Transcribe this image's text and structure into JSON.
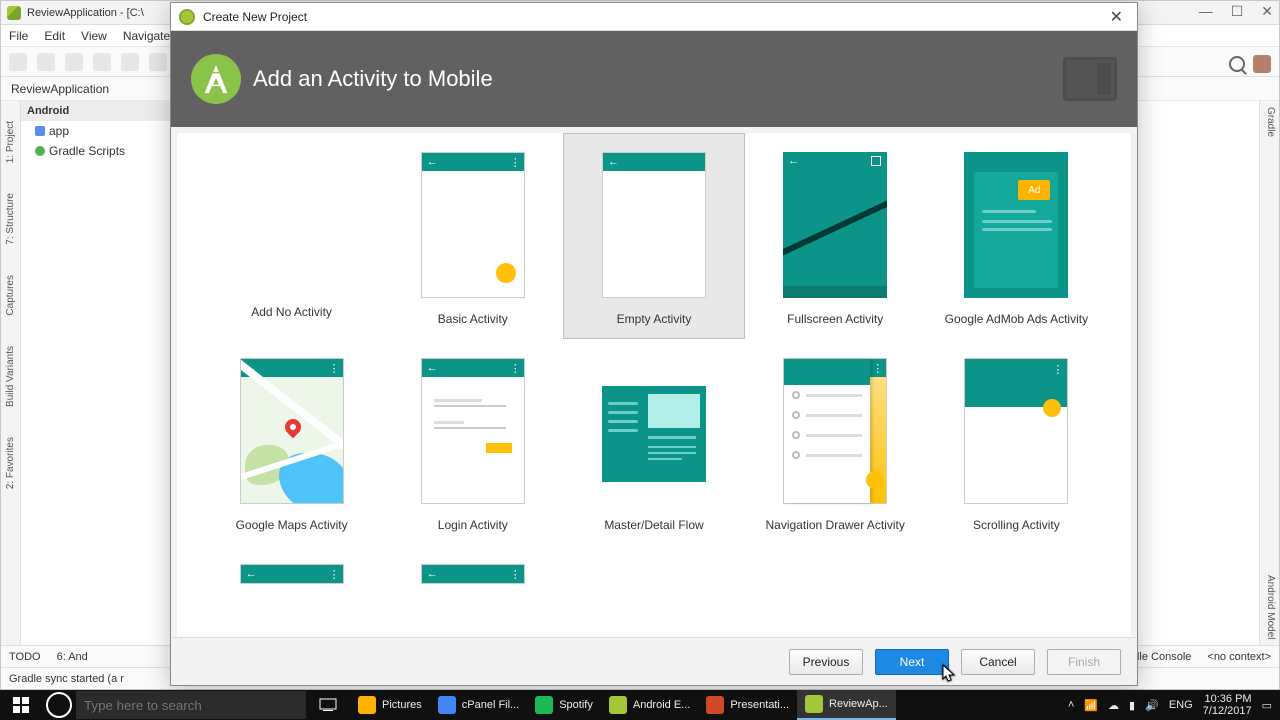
{
  "ide": {
    "title": "ReviewApplication - [C:\\",
    "menu": [
      "File",
      "Edit",
      "View",
      "Navigate"
    ],
    "breadcrumb": "ReviewApplication",
    "project": {
      "header": "Android",
      "nodes": [
        {
          "icon": "#5b8def",
          "label": "app"
        },
        {
          "icon": "#4caf50",
          "label": "Gradle Scripts"
        }
      ]
    },
    "left_tools": [
      "1: Project",
      "7: Structure",
      "Captures",
      "Build Variants",
      "2: Favorites"
    ],
    "right_tools": [
      "Gradle",
      "Android Model"
    ],
    "status_left": [
      "TODO",
      "6: And"
    ],
    "status_msg": "Gradle sync started (a r",
    "status_right": [
      "Gradle Console",
      "<no context>"
    ],
    "win_controls": [
      "—",
      "☐",
      "✕"
    ]
  },
  "dialog": {
    "title": "Create New Project",
    "heading": "Add an Activity to Mobile",
    "activities": [
      {
        "key": "none",
        "label": "Add No Activity"
      },
      {
        "key": "basic",
        "label": "Basic Activity"
      },
      {
        "key": "empty",
        "label": "Empty Activity",
        "selected": true
      },
      {
        "key": "fullscreen",
        "label": "Fullscreen Activity"
      },
      {
        "key": "admob",
        "label": "Google AdMob Ads Activity",
        "ad_text": "Ad"
      },
      {
        "key": "maps",
        "label": "Google Maps Activity"
      },
      {
        "key": "login",
        "label": "Login Activity"
      },
      {
        "key": "master",
        "label": "Master/Detail Flow"
      },
      {
        "key": "navd",
        "label": "Navigation Drawer Activity"
      },
      {
        "key": "scroll",
        "label": "Scrolling Activity"
      }
    ],
    "buttons": {
      "previous": "Previous",
      "next": "Next",
      "cancel": "Cancel",
      "finish": "Finish"
    }
  },
  "taskbar": {
    "search_placeholder": "Type here to search",
    "items": [
      {
        "color": "#ffb300",
        "label": "Pictures"
      },
      {
        "color": "#4285f4",
        "label": "cPanel Fil..."
      },
      {
        "color": "#1db954",
        "label": "Spotify"
      },
      {
        "color": "#a4c639",
        "label": "Android E..."
      },
      {
        "color": "#d24726",
        "label": "Presentati..."
      },
      {
        "color": "#a4c639",
        "label": "ReviewAp...",
        "active": true
      }
    ],
    "lang": "ENG",
    "time": "10:36 PM",
    "date": "7/12/2017"
  }
}
